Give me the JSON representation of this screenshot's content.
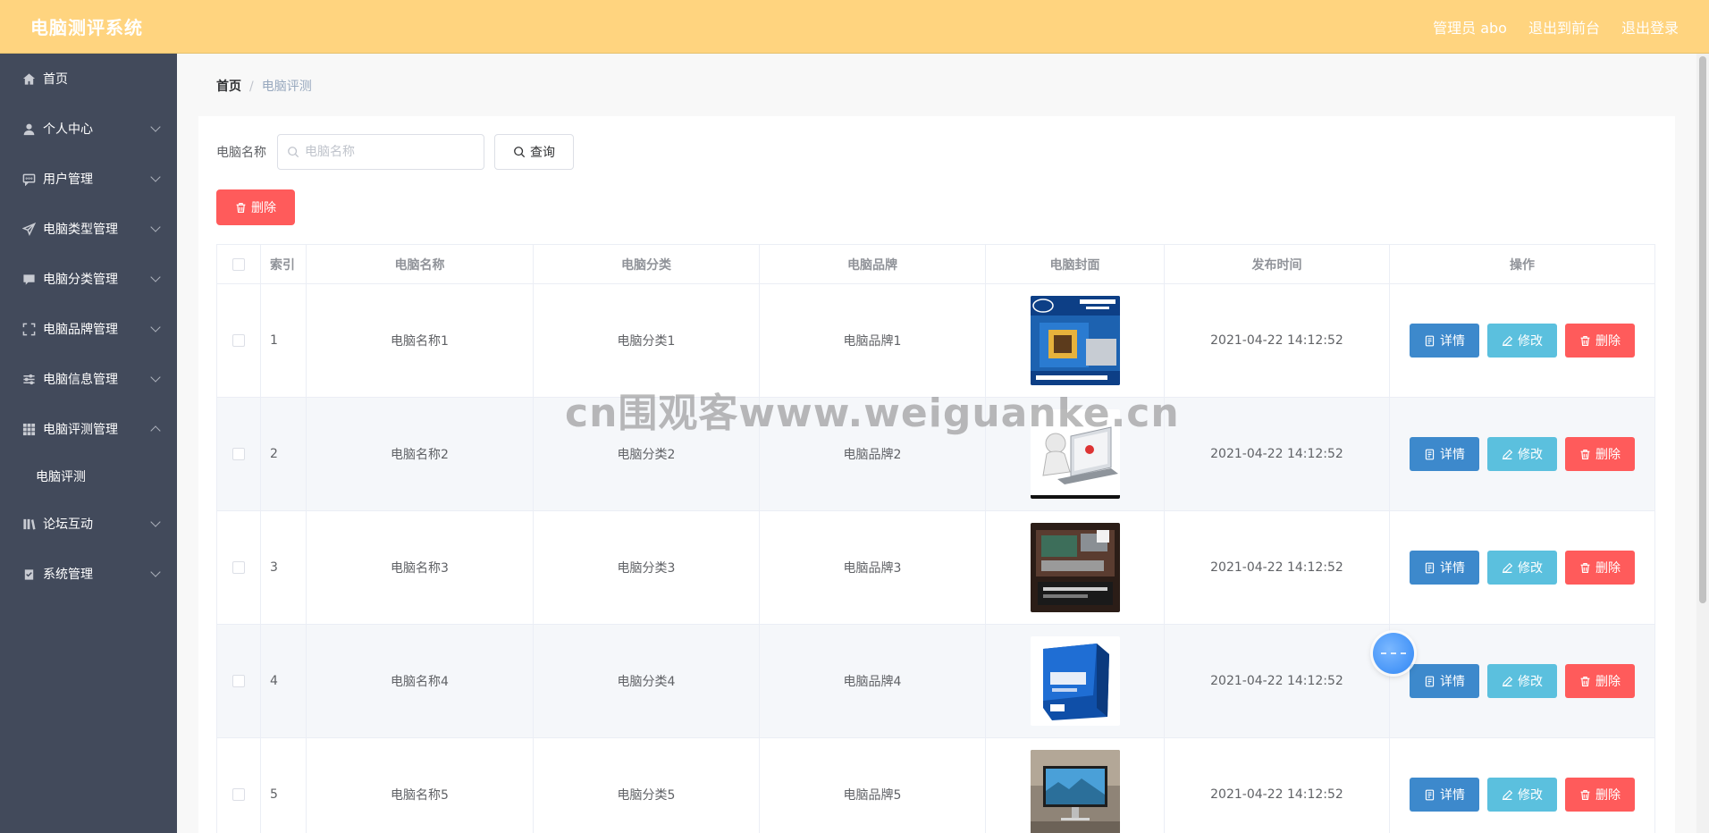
{
  "header": {
    "title": "电脑测评系统",
    "admin": "管理员 abo",
    "to_front": "退出到前台",
    "logout": "退出登录"
  },
  "sidebar": {
    "items": [
      {
        "label": "首页",
        "icon": "home-icon"
      },
      {
        "label": "个人中心",
        "icon": "user-icon"
      },
      {
        "label": "用户管理",
        "icon": "chat-icon"
      },
      {
        "label": "电脑类型管理",
        "icon": "send-icon"
      },
      {
        "label": "电脑分类管理",
        "icon": "message-icon"
      },
      {
        "label": "电脑品牌管理",
        "icon": "fullscreen-icon"
      },
      {
        "label": "电脑信息管理",
        "icon": "sliders-icon"
      },
      {
        "label": "电脑评测管理",
        "icon": "grid-icon"
      },
      {
        "label": "论坛互动",
        "icon": "library-icon"
      },
      {
        "label": "系统管理",
        "icon": "check-clipboard-icon"
      }
    ],
    "active_sub": "电脑评测"
  },
  "breadcrumb": {
    "home": "首页",
    "sep": "/",
    "current": "电脑评测"
  },
  "search": {
    "label": "电脑名称",
    "placeholder": "电脑名称",
    "button": "查询"
  },
  "delete_label": "删除",
  "table": {
    "headers": {
      "index": "索引",
      "name": "电脑名称",
      "category": "电脑分类",
      "brand": "电脑品牌",
      "cover": "电脑封面",
      "time": "发布时间",
      "ops": "操作"
    },
    "rows": [
      {
        "index": "1",
        "name": "电脑名称1",
        "category": "电脑分类1",
        "brand": "电脑品牌1",
        "time": "2021-04-22 14:12:52"
      },
      {
        "index": "2",
        "name": "电脑名称2",
        "category": "电脑分类2",
        "brand": "电脑品牌2",
        "time": "2021-04-22 14:12:52"
      },
      {
        "index": "3",
        "name": "电脑名称3",
        "category": "电脑分类3",
        "brand": "电脑品牌3",
        "time": "2021-04-22 14:12:52"
      },
      {
        "index": "4",
        "name": "电脑名称4",
        "category": "电脑分类4",
        "brand": "电脑品牌4",
        "time": "2021-04-22 14:12:52"
      },
      {
        "index": "5",
        "name": "电脑名称5",
        "category": "电脑分类5",
        "brand": "电脑品牌5",
        "time": "2021-04-22 14:12:52"
      }
    ],
    "ops": {
      "detail": "详情",
      "edit": "修改",
      "delete": "删除"
    }
  },
  "watermark": "cn围观客www.weiguanke.cn",
  "colors": {
    "header_bg": "#ffd47f",
    "sidebar_bg": "#424a5b",
    "detail_btn": "#3d89cc",
    "edit_btn": "#5bc0de",
    "delete_btn": "#ff5b5b"
  }
}
